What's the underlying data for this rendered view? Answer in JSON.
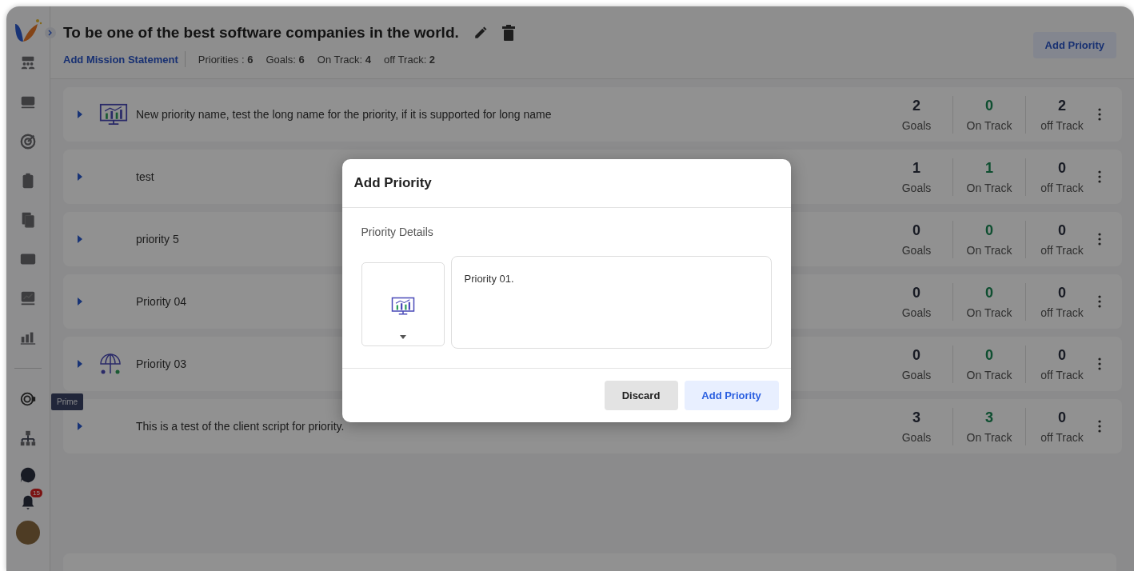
{
  "sidebar": {
    "items": [
      {
        "kind": "team"
      },
      {
        "kind": "board"
      },
      {
        "kind": "target"
      },
      {
        "kind": "clipboard"
      },
      {
        "kind": "documents"
      },
      {
        "kind": "card"
      },
      {
        "kind": "presentation"
      },
      {
        "kind": "bars"
      },
      {
        "kind": "divider"
      },
      {
        "kind": "prime",
        "tooltip": "Prime"
      },
      {
        "kind": "org"
      }
    ],
    "notification_count": "15"
  },
  "header": {
    "title": "To be one of the best software companies in the world.",
    "link": "Add Mission Statement",
    "stats": [
      "Priorities : **6**",
      "Goals: **6**",
      "On Track: **4**",
      "off Track: **2**"
    ],
    "button": "Add Priority"
  },
  "priorities": [
    {
      "kind": "chart",
      "name": "New priority name, test the long name for the priority, if it is supported for long name",
      "stats": [
        {
          "kind": "goals",
          "value": "2",
          "label": "Goals"
        },
        {
          "kind": "on_track",
          "value": "0",
          "label": "On Track"
        },
        {
          "kind": "off_track",
          "value": "2",
          "label": "off Track"
        }
      ]
    },
    {
      "kind": "plain",
      "name": "test",
      "stats": [
        {
          "kind": "goals",
          "value": "1",
          "label": "Goals"
        },
        {
          "kind": "on_track",
          "value": "1",
          "label": "On Track"
        },
        {
          "kind": "off_track",
          "value": "0",
          "label": "off Track"
        }
      ]
    },
    {
      "kind": "plain",
      "name": "priority 5",
      "stats": [
        {
          "kind": "goals",
          "value": "0",
          "label": "Goals"
        },
        {
          "kind": "on_track",
          "value": "0",
          "label": "On Track"
        },
        {
          "kind": "off_track",
          "value": "0",
          "label": "off Track"
        }
      ]
    },
    {
      "kind": "plain",
      "name": "Priority 04",
      "stats": [
        {
          "kind": "goals",
          "value": "0",
          "label": "Goals"
        },
        {
          "kind": "on_track",
          "value": "0",
          "label": "On Track"
        },
        {
          "kind": "off_track",
          "value": "0",
          "label": "off Track"
        }
      ]
    },
    {
      "kind": "umbrella",
      "name": "Priority 03",
      "stats": [
        {
          "kind": "goals",
          "value": "0",
          "label": "Goals"
        },
        {
          "kind": "on_track",
          "value": "0",
          "label": "On Track"
        },
        {
          "kind": "off_track",
          "value": "0",
          "label": "off Track"
        }
      ]
    },
    {
      "kind": "plain",
      "name": "This is a test of the client script for priority.",
      "stats": [
        {
          "kind": "goals",
          "value": "3",
          "label": "Goals"
        },
        {
          "kind": "on_track",
          "value": "3",
          "label": "On Track"
        },
        {
          "kind": "off_track",
          "value": "0",
          "label": "off Track"
        }
      ]
    }
  ],
  "dialog": {
    "title": "Add Priority",
    "section": "Priority Details",
    "name_value": "Priority 01.",
    "buttons": [
      {
        "kind": "secondary",
        "label": "Discard"
      },
      {
        "kind": "primary",
        "label": "Add Priority"
      }
    ]
  }
}
